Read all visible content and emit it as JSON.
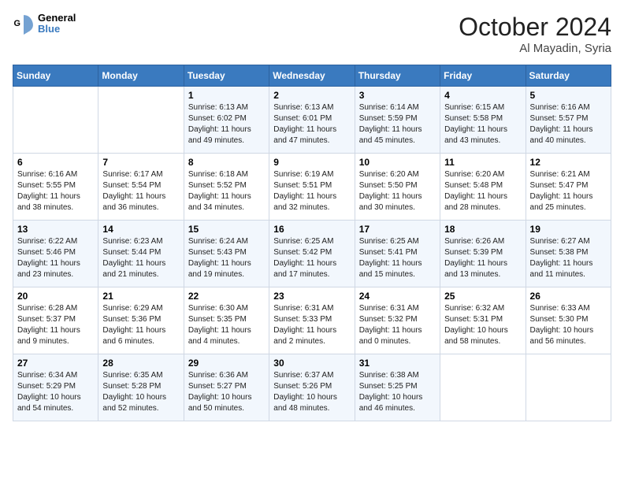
{
  "header": {
    "logo_line1": "General",
    "logo_line2": "Blue",
    "month": "October 2024",
    "location": "Al Mayadin, Syria"
  },
  "days_of_week": [
    "Sunday",
    "Monday",
    "Tuesday",
    "Wednesday",
    "Thursday",
    "Friday",
    "Saturday"
  ],
  "weeks": [
    [
      {
        "day": "",
        "info": ""
      },
      {
        "day": "",
        "info": ""
      },
      {
        "day": "1",
        "info": "Sunrise: 6:13 AM\nSunset: 6:02 PM\nDaylight: 11 hours and 49 minutes."
      },
      {
        "day": "2",
        "info": "Sunrise: 6:13 AM\nSunset: 6:01 PM\nDaylight: 11 hours and 47 minutes."
      },
      {
        "day": "3",
        "info": "Sunrise: 6:14 AM\nSunset: 5:59 PM\nDaylight: 11 hours and 45 minutes."
      },
      {
        "day": "4",
        "info": "Sunrise: 6:15 AM\nSunset: 5:58 PM\nDaylight: 11 hours and 43 minutes."
      },
      {
        "day": "5",
        "info": "Sunrise: 6:16 AM\nSunset: 5:57 PM\nDaylight: 11 hours and 40 minutes."
      }
    ],
    [
      {
        "day": "6",
        "info": "Sunrise: 6:16 AM\nSunset: 5:55 PM\nDaylight: 11 hours and 38 minutes."
      },
      {
        "day": "7",
        "info": "Sunrise: 6:17 AM\nSunset: 5:54 PM\nDaylight: 11 hours and 36 minutes."
      },
      {
        "day": "8",
        "info": "Sunrise: 6:18 AM\nSunset: 5:52 PM\nDaylight: 11 hours and 34 minutes."
      },
      {
        "day": "9",
        "info": "Sunrise: 6:19 AM\nSunset: 5:51 PM\nDaylight: 11 hours and 32 minutes."
      },
      {
        "day": "10",
        "info": "Sunrise: 6:20 AM\nSunset: 5:50 PM\nDaylight: 11 hours and 30 minutes."
      },
      {
        "day": "11",
        "info": "Sunrise: 6:20 AM\nSunset: 5:48 PM\nDaylight: 11 hours and 28 minutes."
      },
      {
        "day": "12",
        "info": "Sunrise: 6:21 AM\nSunset: 5:47 PM\nDaylight: 11 hours and 25 minutes."
      }
    ],
    [
      {
        "day": "13",
        "info": "Sunrise: 6:22 AM\nSunset: 5:46 PM\nDaylight: 11 hours and 23 minutes."
      },
      {
        "day": "14",
        "info": "Sunrise: 6:23 AM\nSunset: 5:44 PM\nDaylight: 11 hours and 21 minutes."
      },
      {
        "day": "15",
        "info": "Sunrise: 6:24 AM\nSunset: 5:43 PM\nDaylight: 11 hours and 19 minutes."
      },
      {
        "day": "16",
        "info": "Sunrise: 6:25 AM\nSunset: 5:42 PM\nDaylight: 11 hours and 17 minutes."
      },
      {
        "day": "17",
        "info": "Sunrise: 6:25 AM\nSunset: 5:41 PM\nDaylight: 11 hours and 15 minutes."
      },
      {
        "day": "18",
        "info": "Sunrise: 6:26 AM\nSunset: 5:39 PM\nDaylight: 11 hours and 13 minutes."
      },
      {
        "day": "19",
        "info": "Sunrise: 6:27 AM\nSunset: 5:38 PM\nDaylight: 11 hours and 11 minutes."
      }
    ],
    [
      {
        "day": "20",
        "info": "Sunrise: 6:28 AM\nSunset: 5:37 PM\nDaylight: 11 hours and 9 minutes."
      },
      {
        "day": "21",
        "info": "Sunrise: 6:29 AM\nSunset: 5:36 PM\nDaylight: 11 hours and 6 minutes."
      },
      {
        "day": "22",
        "info": "Sunrise: 6:30 AM\nSunset: 5:35 PM\nDaylight: 11 hours and 4 minutes."
      },
      {
        "day": "23",
        "info": "Sunrise: 6:31 AM\nSunset: 5:33 PM\nDaylight: 11 hours and 2 minutes."
      },
      {
        "day": "24",
        "info": "Sunrise: 6:31 AM\nSunset: 5:32 PM\nDaylight: 11 hours and 0 minutes."
      },
      {
        "day": "25",
        "info": "Sunrise: 6:32 AM\nSunset: 5:31 PM\nDaylight: 10 hours and 58 minutes."
      },
      {
        "day": "26",
        "info": "Sunrise: 6:33 AM\nSunset: 5:30 PM\nDaylight: 10 hours and 56 minutes."
      }
    ],
    [
      {
        "day": "27",
        "info": "Sunrise: 6:34 AM\nSunset: 5:29 PM\nDaylight: 10 hours and 54 minutes."
      },
      {
        "day": "28",
        "info": "Sunrise: 6:35 AM\nSunset: 5:28 PM\nDaylight: 10 hours and 52 minutes."
      },
      {
        "day": "29",
        "info": "Sunrise: 6:36 AM\nSunset: 5:27 PM\nDaylight: 10 hours and 50 minutes."
      },
      {
        "day": "30",
        "info": "Sunrise: 6:37 AM\nSunset: 5:26 PM\nDaylight: 10 hours and 48 minutes."
      },
      {
        "day": "31",
        "info": "Sunrise: 6:38 AM\nSunset: 5:25 PM\nDaylight: 10 hours and 46 minutes."
      },
      {
        "day": "",
        "info": ""
      },
      {
        "day": "",
        "info": ""
      }
    ]
  ]
}
